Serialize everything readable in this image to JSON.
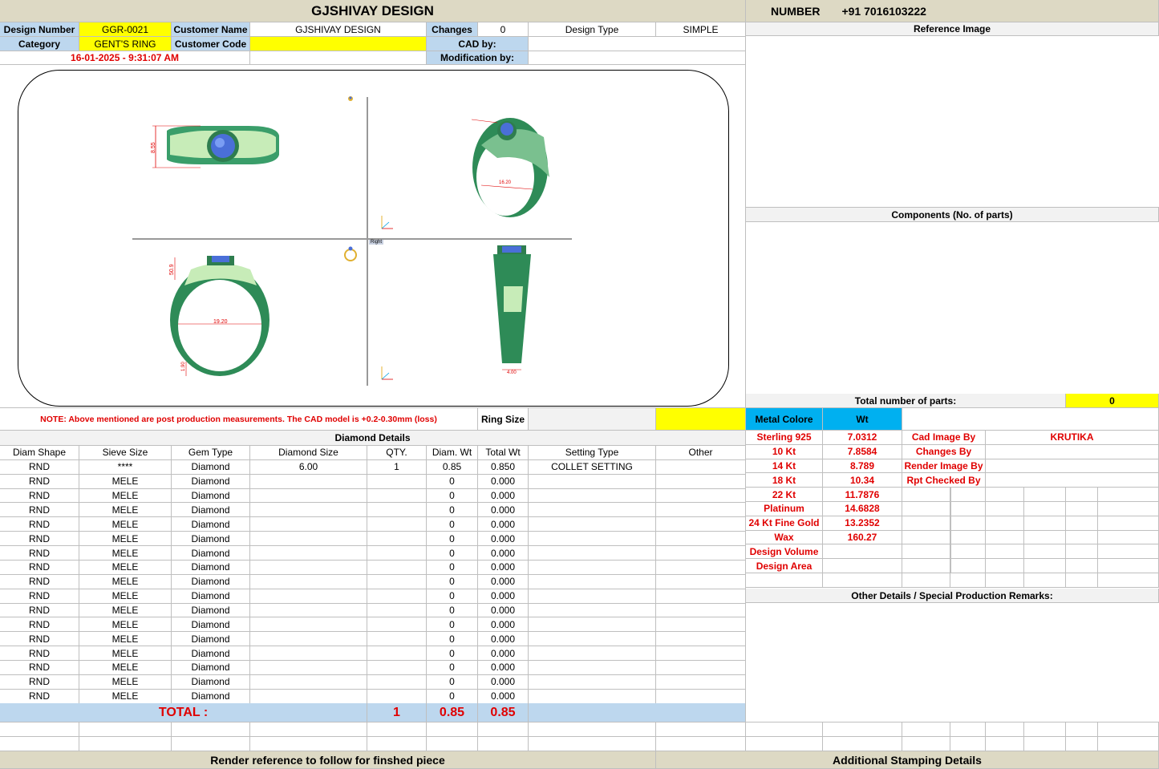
{
  "header": {
    "title": "GJSHIVAY DESIGN",
    "number_label": "NUMBER",
    "number_value": "+91 7016103222"
  },
  "info": {
    "design_number_label": "Design Number",
    "design_number": "GGR-0021",
    "customer_name_label": "Customer Name",
    "customer_name": "GJSHIVAY DESIGN",
    "changes_label": "Changes",
    "changes": "0",
    "design_type_label": "Design Type",
    "design_type": "SIMPLE",
    "category_label": "Category",
    "category": "GENT'S RING",
    "customer_code_label": "Customer Code",
    "customer_code": "",
    "cad_by_label": "CAD by:",
    "timestamp": "16-01-2025 - 9:31:07 AM",
    "modification_label": "Modification by:"
  },
  "right_panel": {
    "reference_image": "Reference Image",
    "components": "Components (No. of parts)",
    "total_parts_label": "Total number of parts:",
    "total_parts": "0"
  },
  "cad_views": {
    "top_height": "8.55",
    "side_width": "16.20",
    "front_height": "50.9",
    "front_width": "19.20",
    "front_bottom": "1.90",
    "profile_bottom": "4.00",
    "view_label": "Right"
  },
  "note": "NOTE: Above mentioned are post production measurements. The CAD model is +0.2-0.30mm (loss)",
  "ring_size_label": "Ring Size",
  "diamond": {
    "title": "Diamond Details",
    "columns": [
      "Diam Shape",
      "Sieve Size",
      "Gem Type",
      "Diamond Size",
      "QTY.",
      "Diam. Wt",
      "Total Wt",
      "Setting Type",
      "Other"
    ],
    "rows": [
      [
        "RND",
        "****",
        "Diamond",
        "6.00",
        "1",
        "0.85",
        "0.850",
        "COLLET SETTING",
        ""
      ],
      [
        "RND",
        "MELE",
        "Diamond",
        "",
        "",
        "0",
        "0.000",
        "",
        ""
      ],
      [
        "RND",
        "MELE",
        "Diamond",
        "",
        "",
        "0",
        "0.000",
        "",
        ""
      ],
      [
        "RND",
        "MELE",
        "Diamond",
        "",
        "",
        "0",
        "0.000",
        "",
        ""
      ],
      [
        "RND",
        "MELE",
        "Diamond",
        "",
        "",
        "0",
        "0.000",
        "",
        ""
      ],
      [
        "RND",
        "MELE",
        "Diamond",
        "",
        "",
        "0",
        "0.000",
        "",
        ""
      ],
      [
        "RND",
        "MELE",
        "Diamond",
        "",
        "",
        "0",
        "0.000",
        "",
        ""
      ],
      [
        "RND",
        "MELE",
        "Diamond",
        "",
        "",
        "0",
        "0.000",
        "",
        ""
      ],
      [
        "RND",
        "MELE",
        "Diamond",
        "",
        "",
        "0",
        "0.000",
        "",
        ""
      ],
      [
        "RND",
        "MELE",
        "Diamond",
        "",
        "",
        "0",
        "0.000",
        "",
        ""
      ],
      [
        "RND",
        "MELE",
        "Diamond",
        "",
        "",
        "0",
        "0.000",
        "",
        ""
      ],
      [
        "RND",
        "MELE",
        "Diamond",
        "",
        "",
        "0",
        "0.000",
        "",
        ""
      ],
      [
        "RND",
        "MELE",
        "Diamond",
        "",
        "",
        "0",
        "0.000",
        "",
        ""
      ],
      [
        "RND",
        "MELE",
        "Diamond",
        "",
        "",
        "0",
        "0.000",
        "",
        ""
      ],
      [
        "RND",
        "MELE",
        "Diamond",
        "",
        "",
        "0",
        "0.000",
        "",
        ""
      ],
      [
        "RND",
        "MELE",
        "Diamond",
        "",
        "",
        "0",
        "0.000",
        "",
        ""
      ],
      [
        "RND",
        "MELE",
        "Diamond",
        "",
        "",
        "0",
        "0.000",
        "",
        ""
      ]
    ],
    "total_label": "TOTAL :",
    "total_qty": "1",
    "total_diam_wt": "0.85",
    "total_wt": "0.85"
  },
  "metal": {
    "header_color": "Metal Colore",
    "header_wt": "Wt",
    "rows": [
      [
        "Sterling 925",
        "7.0312"
      ],
      [
        "10 Kt",
        "7.8584"
      ],
      [
        "14 Kt",
        "8.789"
      ],
      [
        "18 Kt",
        "10.34"
      ],
      [
        "22 Kt",
        "11.7876"
      ],
      [
        "Platinum",
        "14.6828"
      ],
      [
        "24 Kt Fine Gold",
        "13.2352"
      ],
      [
        "Wax",
        "160.27"
      ],
      [
        "Design Volume",
        ""
      ],
      [
        "Design Area",
        ""
      ]
    ]
  },
  "credits": [
    [
      "Cad Image By",
      "KRUTIKA"
    ],
    [
      "Changes By",
      ""
    ],
    [
      "Render Image By",
      ""
    ],
    [
      "Rpt Checked By",
      ""
    ]
  ],
  "other_details": "Other Details / Special Production Remarks:",
  "footer": {
    "render_reference": "Render reference to follow for finshed piece",
    "stamping": "Additional Stamping Details"
  },
  "colors": {
    "tan": "#ddd9c4",
    "yellow": "#ffff00",
    "blue": "#bdd7ee",
    "metal_header": "#00b0f0",
    "red": "#e00000",
    "ring_green": "#2e8b57",
    "gem_blue": "#4a6fd8"
  }
}
